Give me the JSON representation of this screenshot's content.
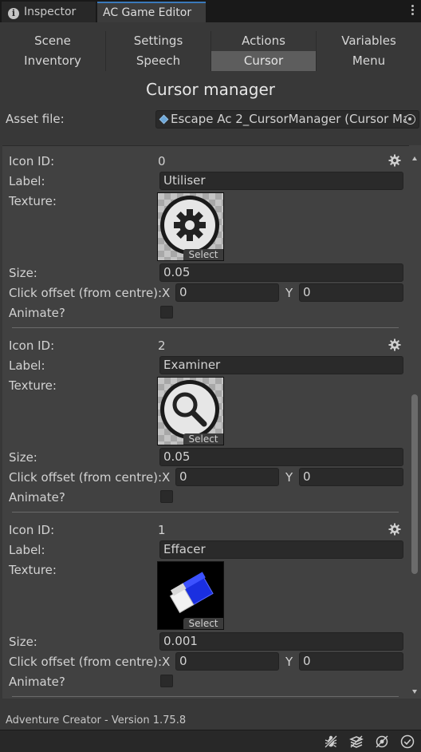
{
  "tabs": [
    {
      "label": "Inspector",
      "icon": "info-icon"
    },
    {
      "label": "AC Game Editor"
    }
  ],
  "nav": {
    "row1": [
      "Scene",
      "Settings",
      "Actions",
      "Variables"
    ],
    "row2": [
      "Inventory",
      "Speech",
      "Cursor",
      "Menu"
    ],
    "active": "Cursor"
  },
  "title": "Cursor manager",
  "asset": {
    "label": "Asset file:",
    "value": "Escape Ac 2_CursorManager (Cursor Ma"
  },
  "field_labels": {
    "icon_id": "Icon ID:",
    "label": "Label:",
    "texture": "Texture:",
    "size": "Size:",
    "click_offset": "Click offset (from centre):",
    "x": "X",
    "y": "Y",
    "animate": "Animate?",
    "select": "Select"
  },
  "cursors": [
    {
      "id": "0",
      "label": "Utiliser",
      "texture": "gear-icon",
      "size": "0.05",
      "offset_x": "0",
      "offset_y": "0",
      "animate": false
    },
    {
      "id": "2",
      "label": "Examiner",
      "texture": "magnifier-icon",
      "size": "0.05",
      "offset_x": "0",
      "offset_y": "0",
      "animate": false
    },
    {
      "id": "1",
      "label": "Effacer",
      "texture": "eraser-icon",
      "size": "0.001",
      "offset_x": "0",
      "offset_y": "0",
      "animate": false
    }
  ],
  "footer": {
    "version": "Adventure Creator - Version 1.75.8"
  },
  "colors": {
    "background": "#383838",
    "panel": "#414141",
    "active_tab": "#5d5d5d",
    "accent": "#3a79bb"
  }
}
